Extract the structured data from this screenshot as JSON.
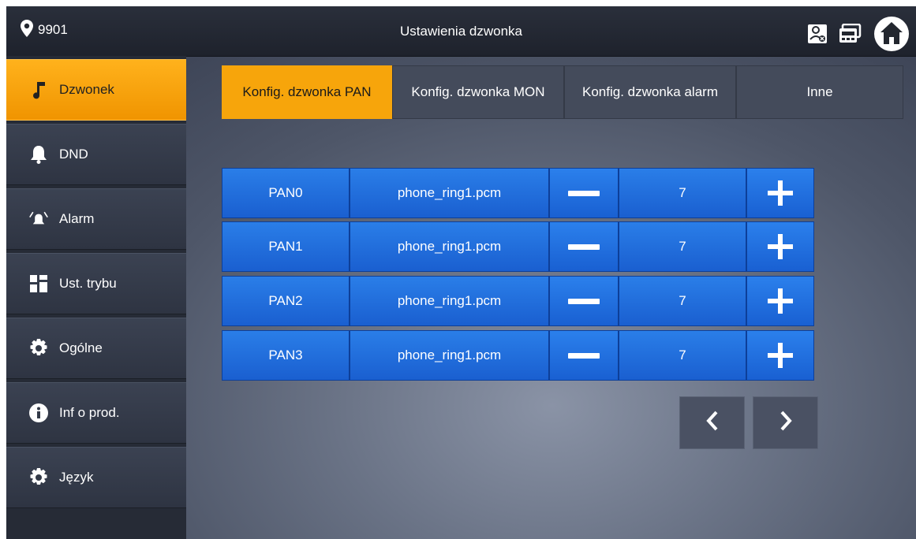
{
  "header": {
    "location": "9901",
    "title": "Ustawienia dzwonka"
  },
  "icons": {
    "location": "map-pin-icon",
    "monitor": "monitor-call-icon",
    "messages": "message-icon",
    "home": "home-icon"
  },
  "sidebar": {
    "items": [
      {
        "label": "Dzwonek",
        "icon": "music-note-icon",
        "active": true
      },
      {
        "label": "DND",
        "icon": "bell-icon",
        "active": false
      },
      {
        "label": "Alarm",
        "icon": "alarm-icon",
        "active": false
      },
      {
        "label": "Ust. trybu",
        "icon": "mode-grid-icon",
        "active": false
      },
      {
        "label": "Ogólne",
        "icon": "gear-icon",
        "active": false
      },
      {
        "label": "Inf o prod.",
        "icon": "info-icon",
        "active": false
      },
      {
        "label": "Język",
        "icon": "gear-icon",
        "active": false
      }
    ]
  },
  "tabs": [
    {
      "label": "Konfig. dzwonka PAN",
      "active": true
    },
    {
      "label": "Konfig. dzwonka MON",
      "active": false
    },
    {
      "label": "Konfig. dzwonka alarm",
      "active": false
    },
    {
      "label": "Inne",
      "active": false
    }
  ],
  "rows": [
    {
      "name": "PAN0",
      "ringtone": "phone_ring1.pcm",
      "volume": "7"
    },
    {
      "name": "PAN1",
      "ringtone": "phone_ring1.pcm",
      "volume": "7"
    },
    {
      "name": "PAN2",
      "ringtone": "phone_ring1.pcm",
      "volume": "7"
    },
    {
      "name": "PAN3",
      "ringtone": "phone_ring1.pcm",
      "volume": "7"
    }
  ],
  "pagination": {
    "prev": "chevron-left-icon",
    "next": "chevron-right-icon"
  },
  "colors": {
    "accent": "#f7a50b",
    "button_blue": "#1a6ee0",
    "topbar": "#23272f"
  }
}
